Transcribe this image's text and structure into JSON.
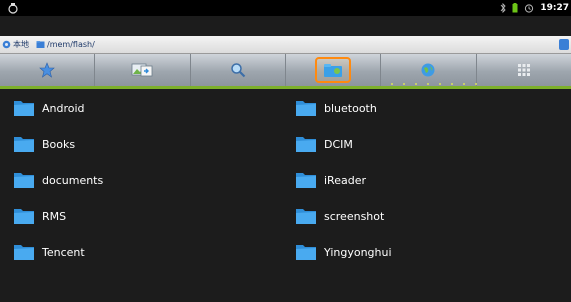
{
  "status_bar": {
    "left_icon": "usb-debug-icon",
    "icons": [
      "bluetooth-icon",
      "battery-icon",
      "alarm-icon"
    ],
    "time": "19:27"
  },
  "path_bar": {
    "home_label": "本地",
    "path": "/mem/flash/"
  },
  "toolbar": {
    "buttons": [
      {
        "name": "favorites",
        "icon": "star-icon"
      },
      {
        "name": "import",
        "icon": "import-image-icon"
      },
      {
        "name": "search",
        "icon": "search-icon"
      },
      {
        "name": "file-browser",
        "icon": "folder-browser-icon",
        "active": true
      },
      {
        "name": "network",
        "icon": "globe-icon"
      },
      {
        "name": "apps",
        "icon": "grid-icon"
      }
    ]
  },
  "files": {
    "left": [
      "Android",
      "Books",
      "documents",
      "RMS",
      "Tencent"
    ],
    "right": [
      "bluetooth",
      "DCIM",
      "iReader",
      "screenshot",
      "Yingyonghui"
    ]
  },
  "colors": {
    "background": "#1c1c1c",
    "accent_green": "#7db02a",
    "active_orange": "#ff8a10",
    "folder_blue": "#3aa0e8"
  }
}
